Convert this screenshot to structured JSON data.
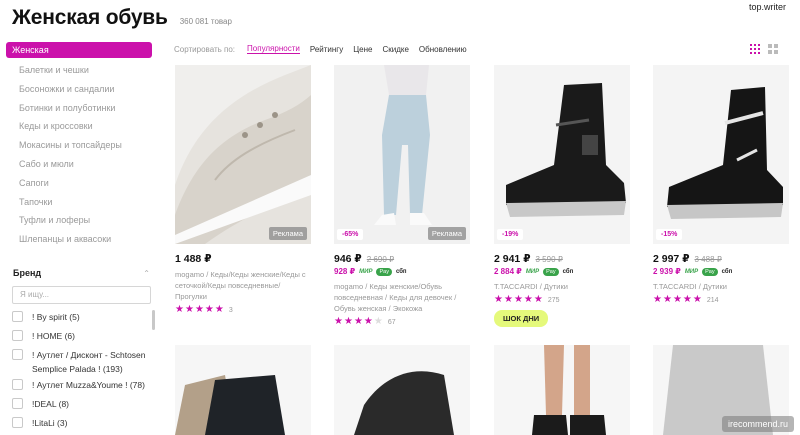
{
  "watermark_top": "top.writer",
  "header": {
    "title": "Женская обувь",
    "count": "360 081 товар"
  },
  "sidebar": {
    "active": "Женская",
    "items": [
      "Балетки и чешки",
      "Босоножки и сандалии",
      "Ботинки и полуботинки",
      "Кеды и кроссовки",
      "Мокасины и топсайдеры",
      "Сабо и мюли",
      "Сапоги",
      "Тапочки",
      "Туфли и лоферы",
      "Шлепанцы и аквасоки"
    ]
  },
  "brand": {
    "title": "Бренд",
    "search_placeholder": "Я ищу...",
    "items": [
      "! By spirit (5)",
      "! HOME (6)",
      "! Аутлет / Дисконт - Schtosen Semplice Palada ! (193)",
      "! Аутлет Muzza&Youme ! (78)",
      "!DEAL (8)",
      "!LitaLi (3)"
    ]
  },
  "sort": {
    "label": "Сортировать по:",
    "options": [
      "Популярности",
      "Рейтингу",
      "Цене",
      "Скидке",
      "Обновлению"
    ],
    "active": "Популярности"
  },
  "products": [
    {
      "price": "1 488 ₽",
      "old_price": "",
      "pay_price": "",
      "ad": "Реклама",
      "discount": "",
      "desc": "mogamo / Кеды/Кеды женские/Кеды с сеточкой/Кеды повседневные/Прогулки",
      "stars": 5,
      "reviews": "3"
    },
    {
      "price": "946 ₽",
      "old_price": "2 690 ₽",
      "pay_price": "928 ₽",
      "ad": "Реклама",
      "discount": "-65%",
      "desc": "mogamo / Кеды женские/Обувь повседневная / Кеды для девочек / Обувь женская / Экокожа",
      "stars": 4,
      "reviews": "67"
    },
    {
      "price": "2 941 ₽",
      "old_price": "3 590 ₽",
      "pay_price": "2 884 ₽",
      "ad": "",
      "discount": "-19%",
      "desc": "T.TACCARDI / Дутики",
      "stars": 5,
      "reviews": "275",
      "badge": "ШОК ДНИ"
    },
    {
      "price": "2 997 ₽",
      "old_price": "3 488 ₽",
      "pay_price": "2 939 ₽",
      "ad": "",
      "discount": "-15%",
      "desc": "T.TACCARDI / Дутики",
      "stars": 5,
      "reviews": "214"
    }
  ],
  "payment": {
    "mir": "МИР",
    "chip": "Pay",
    "sbp": "сбп"
  },
  "watermark_bottom": "irecommend.ru",
  "colors": {
    "accent": "#cb11ab",
    "badge": "#e5f97b",
    "pay_green": "#39a34a"
  },
  "icons": [
    "grid-small-icon",
    "grid-large-icon",
    "star-icon",
    "checkbox-icon",
    "chevron-up-icon"
  ]
}
